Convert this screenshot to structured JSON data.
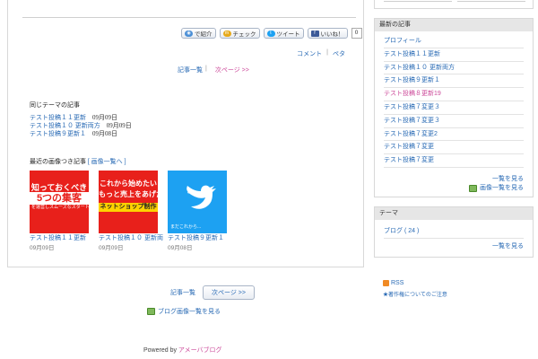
{
  "share": {
    "introduce": "で紹介",
    "check": "チェック",
    "tweet": "ツイート",
    "like": "いいね！",
    "like_count": "0"
  },
  "meta": {
    "comment": "コメント",
    "separator": "|",
    "pe": "ペタ"
  },
  "pager_top": {
    "list": "記事一覧",
    "separator": "|",
    "next": "次ページ >>"
  },
  "theme": {
    "title": "同じテーマの記事",
    "items": [
      {
        "label": "テスト投稿１１更新",
        "date": "09月09日"
      },
      {
        "label": "テスト投稿１０ 更新両方",
        "date": "09月09日"
      },
      {
        "label": "テスト投稿９更新１",
        "date": "09月08日"
      }
    ]
  },
  "recent_images": {
    "title": "最近の画像つき記事",
    "link": "[ 画像一覧へ ]",
    "items": [
      {
        "overlay_title": "知っておくべき",
        "overlay_band": "5つの集客",
        "overlay_small": "を運営しスムーズなスタートアッ",
        "caption": "テスト投稿１１更新",
        "date": "09月09日"
      },
      {
        "overlay_title": "これから始めたい",
        "overlay_sub": "もっと売上をあげた",
        "overlay_band": "ネットショップ制作",
        "caption": "テスト投稿１０ 更新両",
        "date": "09月09日"
      },
      {
        "overlay_caption": "まだこれから...",
        "caption": "テスト投稿９更新１",
        "date": "09月08日"
      }
    ]
  },
  "pager_bottom": {
    "list": "記事一覧",
    "next": "次ページ >>"
  },
  "blog_images_link": "ブログ画像一覧を見る",
  "powered": {
    "prefix": "Powered by",
    "brand": "アメーバブログ"
  },
  "sidebar": {
    "latest": {
      "heading": "最新の記事",
      "items": [
        {
          "label": "プロフィール",
          "visited": false
        },
        {
          "label": "テスト投稿１１更新",
          "visited": false
        },
        {
          "label": "テスト投稿１０ 更新両方",
          "visited": false
        },
        {
          "label": "テスト投稿９更新１",
          "visited": false
        },
        {
          "label": "テスト投稿８更新19",
          "visited": true
        },
        {
          "label": "テスト投稿７変更３",
          "visited": false
        },
        {
          "label": "テスト投稿７変更３",
          "visited": false
        },
        {
          "label": "テスト投稿７変更2",
          "visited": false
        },
        {
          "label": "テスト投稿７変更",
          "visited": false
        },
        {
          "label": "テスト投稿７変更",
          "visited": false
        }
      ],
      "more": "一覧を見る",
      "images": "画像一覧を見る"
    },
    "theme": {
      "heading": "テーマ",
      "items": [
        {
          "label": "ブログ ( 24 )"
        }
      ],
      "more": "一覧を見る"
    },
    "rss": "RSS",
    "rss_note": "★著作権についてのご注意"
  },
  "colors": {
    "link": "#2a6bb5",
    "visited": "#cc4a9a",
    "twitter": "#1da1f2",
    "accent_red": "#e8201b"
  }
}
